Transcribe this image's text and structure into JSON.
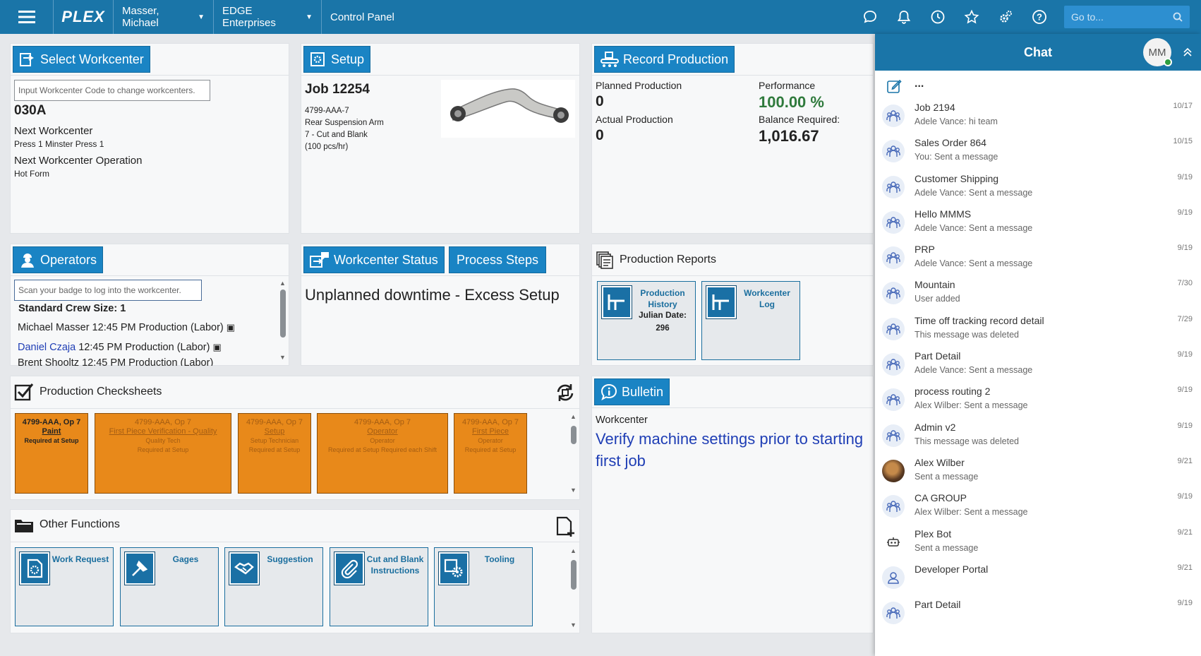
{
  "topbar": {
    "logo": "PLEX",
    "user": "Masser, Michael",
    "company": "EDGE Enterprises",
    "page": "Control Panel",
    "goto_placeholder": "Go to..."
  },
  "select_workcenter": {
    "button": "Select Workcenter",
    "input_placeholder": "Input Workcenter Code to change workcenters.",
    "code": "030A",
    "next_label": "Next Workcenter",
    "next_value": "Press 1 Minster Press 1",
    "next_op_label": "Next Workcenter Operation",
    "next_op_value": "Hot Form"
  },
  "setup": {
    "button": "Setup",
    "job": "Job 12254",
    "part": "4799-AAA-7",
    "desc": "Rear Suspension Arm",
    "op": "7 - Cut and Blank",
    "rate": "(100 pcs/hr)"
  },
  "record": {
    "button": "Record Production",
    "planned_label": "Planned Production",
    "planned_value": "0",
    "actual_label": "Actual Production",
    "actual_value": "0",
    "performance_label": "Performance",
    "performance_value": "100.00 %",
    "balance_label": "Balance Required:",
    "balance_value": "1,016.67"
  },
  "operators": {
    "button": "Operators",
    "badge_placeholder": "Scan your badge to log into the workcenter.",
    "crew": "Standard Crew Size: 1",
    "rows": [
      {
        "name": "Michael Masser",
        "rest": " 12:45 PM Production (Labor)"
      },
      {
        "name": "Daniel Czaja",
        "rest": " 12:45 PM Production (Labor)"
      },
      {
        "name": "Brent Shooltz",
        "rest": " 12:45 PM Production (Labor)"
      }
    ]
  },
  "workcenter_status": {
    "button": "Workcenter Status",
    "button2": "Process Steps",
    "status": "Unplanned downtime - Excess Setup"
  },
  "reports": {
    "title": "Production Reports",
    "items": [
      {
        "label": "Production History",
        "sub1": "Julian Date:",
        "sub2": "296"
      },
      {
        "label": "Workcenter Log"
      }
    ]
  },
  "checksheets": {
    "title": "Production Checksheets",
    "items": [
      {
        "l1": "4799-AAA, Op 7",
        "l2": "Paint",
        "l3": "",
        "l4": "Required at Setup"
      },
      {
        "l1": "4799-AAA, Op 7",
        "l2": "First Piece Verification - Quality",
        "l3": "Quality Tech",
        "l4": "Required at Setup"
      },
      {
        "l1": "4799-AAA, Op 7",
        "l2": "Setup",
        "l3": "Setup Technician",
        "l4": "Required at Setup"
      },
      {
        "l1": "4799-AAA, Op 7",
        "l2": "Operator",
        "l3": "Operator",
        "l4": "Required at Setup Required each Shift"
      },
      {
        "l1": "4799-AAA, Op 7",
        "l2": "First Piece",
        "l3": "Operator",
        "l4": "Required at Setup"
      }
    ]
  },
  "bulletin": {
    "button": "Bulletin",
    "label": "Workcenter",
    "message": "Verify machine settings prior to starting first job"
  },
  "other": {
    "title": "Other Functions",
    "items": [
      {
        "label": "Work Request",
        "icon": "work-request-icon"
      },
      {
        "label": "Gages",
        "icon": "gages-icon"
      },
      {
        "label": "Suggestion",
        "icon": "handshake-icon"
      },
      {
        "label": "Cut and Blank Instructions",
        "icon": "paperclip-icon"
      },
      {
        "label": "Tooling",
        "icon": "tooling-icon"
      }
    ]
  },
  "chat": {
    "title": "Chat",
    "avatar": "MM",
    "more": "...",
    "items": [
      {
        "name": "Job 2194",
        "msg": "Adele Vance: hi team",
        "date": "10/17",
        "icon": "group"
      },
      {
        "name": "Sales Order 864",
        "msg": "You: Sent a message",
        "date": "10/15",
        "icon": "group"
      },
      {
        "name": "Customer Shipping",
        "msg": "Adele Vance: Sent a message",
        "date": "9/19",
        "icon": "group"
      },
      {
        "name": "Hello MMMS",
        "msg": "Adele Vance: Sent a message",
        "date": "9/19",
        "icon": "group"
      },
      {
        "name": "PRP",
        "msg": "Adele Vance: Sent a message",
        "date": "9/19",
        "icon": "group"
      },
      {
        "name": "Mountain",
        "msg": "User added",
        "date": "7/30",
        "icon": "group"
      },
      {
        "name": "Time off tracking record detail",
        "msg": "This message was deleted",
        "date": "7/29",
        "icon": "group"
      },
      {
        "name": "Part Detail",
        "msg": "Adele Vance: Sent a message",
        "date": "9/19",
        "icon": "group"
      },
      {
        "name": "process routing 2",
        "msg": "Alex Wilber: Sent a message",
        "date": "9/19",
        "icon": "group"
      },
      {
        "name": "Admin v2",
        "msg": "This message was deleted",
        "date": "9/19",
        "icon": "group"
      },
      {
        "name": "Alex Wilber",
        "msg": "Sent a message",
        "date": "9/21",
        "icon": "photo"
      },
      {
        "name": "CA GROUP",
        "msg": "Alex Wilber: Sent a message",
        "date": "9/19",
        "icon": "group"
      },
      {
        "name": "Plex Bot",
        "msg": "Sent a message",
        "date": "9/21",
        "icon": "bot"
      },
      {
        "name": "Developer Portal",
        "msg": "",
        "date": "9/21",
        "icon": "person"
      },
      {
        "name": "Part Detail",
        "msg": "",
        "date": "9/19",
        "icon": "group"
      }
    ]
  }
}
